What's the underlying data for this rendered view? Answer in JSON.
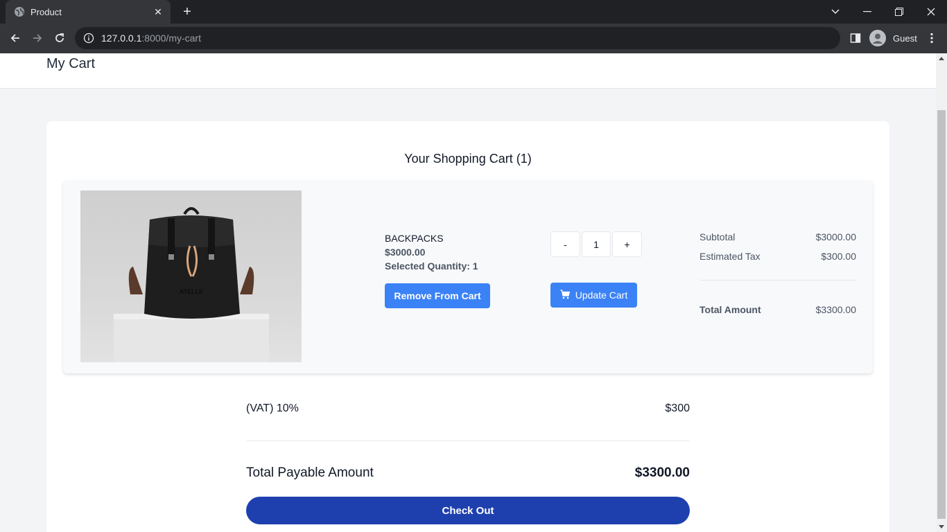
{
  "browser": {
    "tab_title": "Product",
    "url_host": "127.0.0.1",
    "url_path": ":8000/my-cart",
    "profile_name": "Guest"
  },
  "header": {
    "title": "My Cart"
  },
  "cart": {
    "title": "Your Shopping Cart (1)",
    "item": {
      "name": "BACKPACKS",
      "price": "$3000.00",
      "selected_quantity": "Selected Quantity: 1",
      "image_logo_text": "ATELLE",
      "remove_label": "Remove From Cart",
      "decrement_label": "-",
      "quantity": "1",
      "increment_label": "+",
      "update_label": "Update Cart"
    },
    "summary": {
      "subtotal_label": "Subtotal",
      "subtotal_value": "$3000.00",
      "tax_label": "Estimated Tax",
      "tax_value": "$300.00",
      "total_label": "Total Amount",
      "total_value": "$3300.00"
    },
    "vat": {
      "label": "(VAT)",
      "percent": "10%",
      "value": "$300"
    },
    "payable": {
      "label": "Total Payable Amount",
      "value": "$3300.00"
    },
    "checkout_label": "Check Out"
  },
  "colors": {
    "primary_button": "#3b82f6",
    "checkout_button": "#1e40af"
  }
}
